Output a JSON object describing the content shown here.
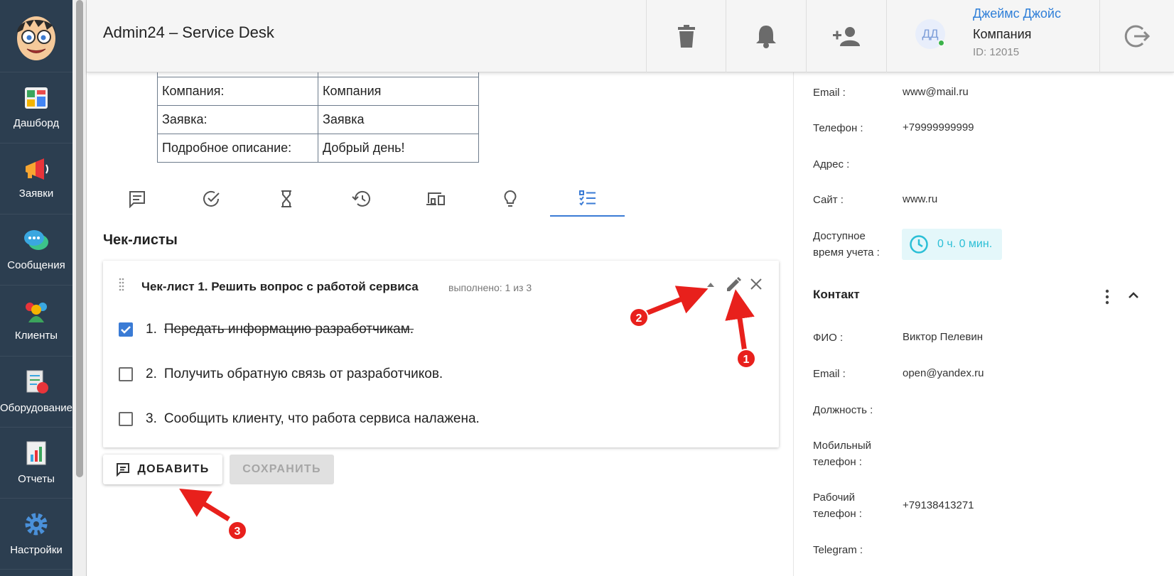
{
  "sidebar": {
    "items": [
      {
        "label": "Дашборд",
        "icon": "dashboard-icon"
      },
      {
        "label": "Заявки",
        "icon": "megaphone-icon"
      },
      {
        "label": "Сообщения",
        "icon": "chat-bubbles-icon"
      },
      {
        "label": "Клиенты",
        "icon": "clients-icon"
      },
      {
        "label": "Оборудование",
        "icon": "equipment-icon"
      },
      {
        "label": "Отчеты",
        "icon": "reports-icon"
      },
      {
        "label": "Настройки",
        "icon": "gear-icon"
      }
    ]
  },
  "header": {
    "title": "Admin24 – Service Desk",
    "user": {
      "initials": "ДД",
      "name": "Джеймс Джойс",
      "company": "Компания",
      "id": "ID: 12015"
    }
  },
  "info_table": [
    {
      "label": "Компания:",
      "value": "Компания"
    },
    {
      "label": "Заявка:",
      "value": "Заявка"
    },
    {
      "label": "Подробное описание:",
      "value": "Добрый день!"
    }
  ],
  "tabs": [
    "comments-icon",
    "check-circle-icon",
    "hourglass-icon",
    "history-icon",
    "devices-icon",
    "lightbulb-icon",
    "checklist-icon"
  ],
  "checklists": {
    "section_title": "Чек-листы",
    "card": {
      "title": "Чек-лист 1. Решить вопрос с работой сервиса",
      "progress": "выполнено: 1 из 3",
      "items": [
        {
          "num": "1.",
          "text": "Передать информацию разработчикам.",
          "checked": true
        },
        {
          "num": "2.",
          "text": "Получить обратную связь от разработчиков.",
          "checked": false
        },
        {
          "num": "3.",
          "text": "Сообщить клиенту, что работа сервиса налажена.",
          "checked": false
        }
      ]
    },
    "add_label": "ДОБАВИТЬ",
    "save_label": "СОХРАНИТЬ"
  },
  "client": {
    "email_label": "Email :",
    "email": "www@mail.ru",
    "phone_label": "Телефон :",
    "phone": "+79999999999",
    "address_label": "Адрес :",
    "site_label": "Сайт :",
    "site": "www.ru",
    "time_label_1": "Доступное",
    "time_label_2": "время учета :",
    "time": "0 ч. 0 мин."
  },
  "contact": {
    "title": "Контакт",
    "fio_label": "ФИО :",
    "fio": "Виктор Пелевин",
    "email_label": "Email :",
    "email": "open@yandex.ru",
    "position_label": "Должность :",
    "mobile_label_1": "Мобильный",
    "mobile_label_2": "телефон :",
    "work_label_1": "Рабочий",
    "work_label_2": "телефон :",
    "work_phone": "+79138413271",
    "telegram_label": "Telegram :"
  },
  "annotations": [
    "1",
    "2",
    "3"
  ],
  "colors": {
    "accent": "#3a7bd5",
    "sidebar": "#2c3e50",
    "annotation": "#e8201c",
    "link": "#2f7fd8",
    "chip": "#2bbfd6"
  }
}
